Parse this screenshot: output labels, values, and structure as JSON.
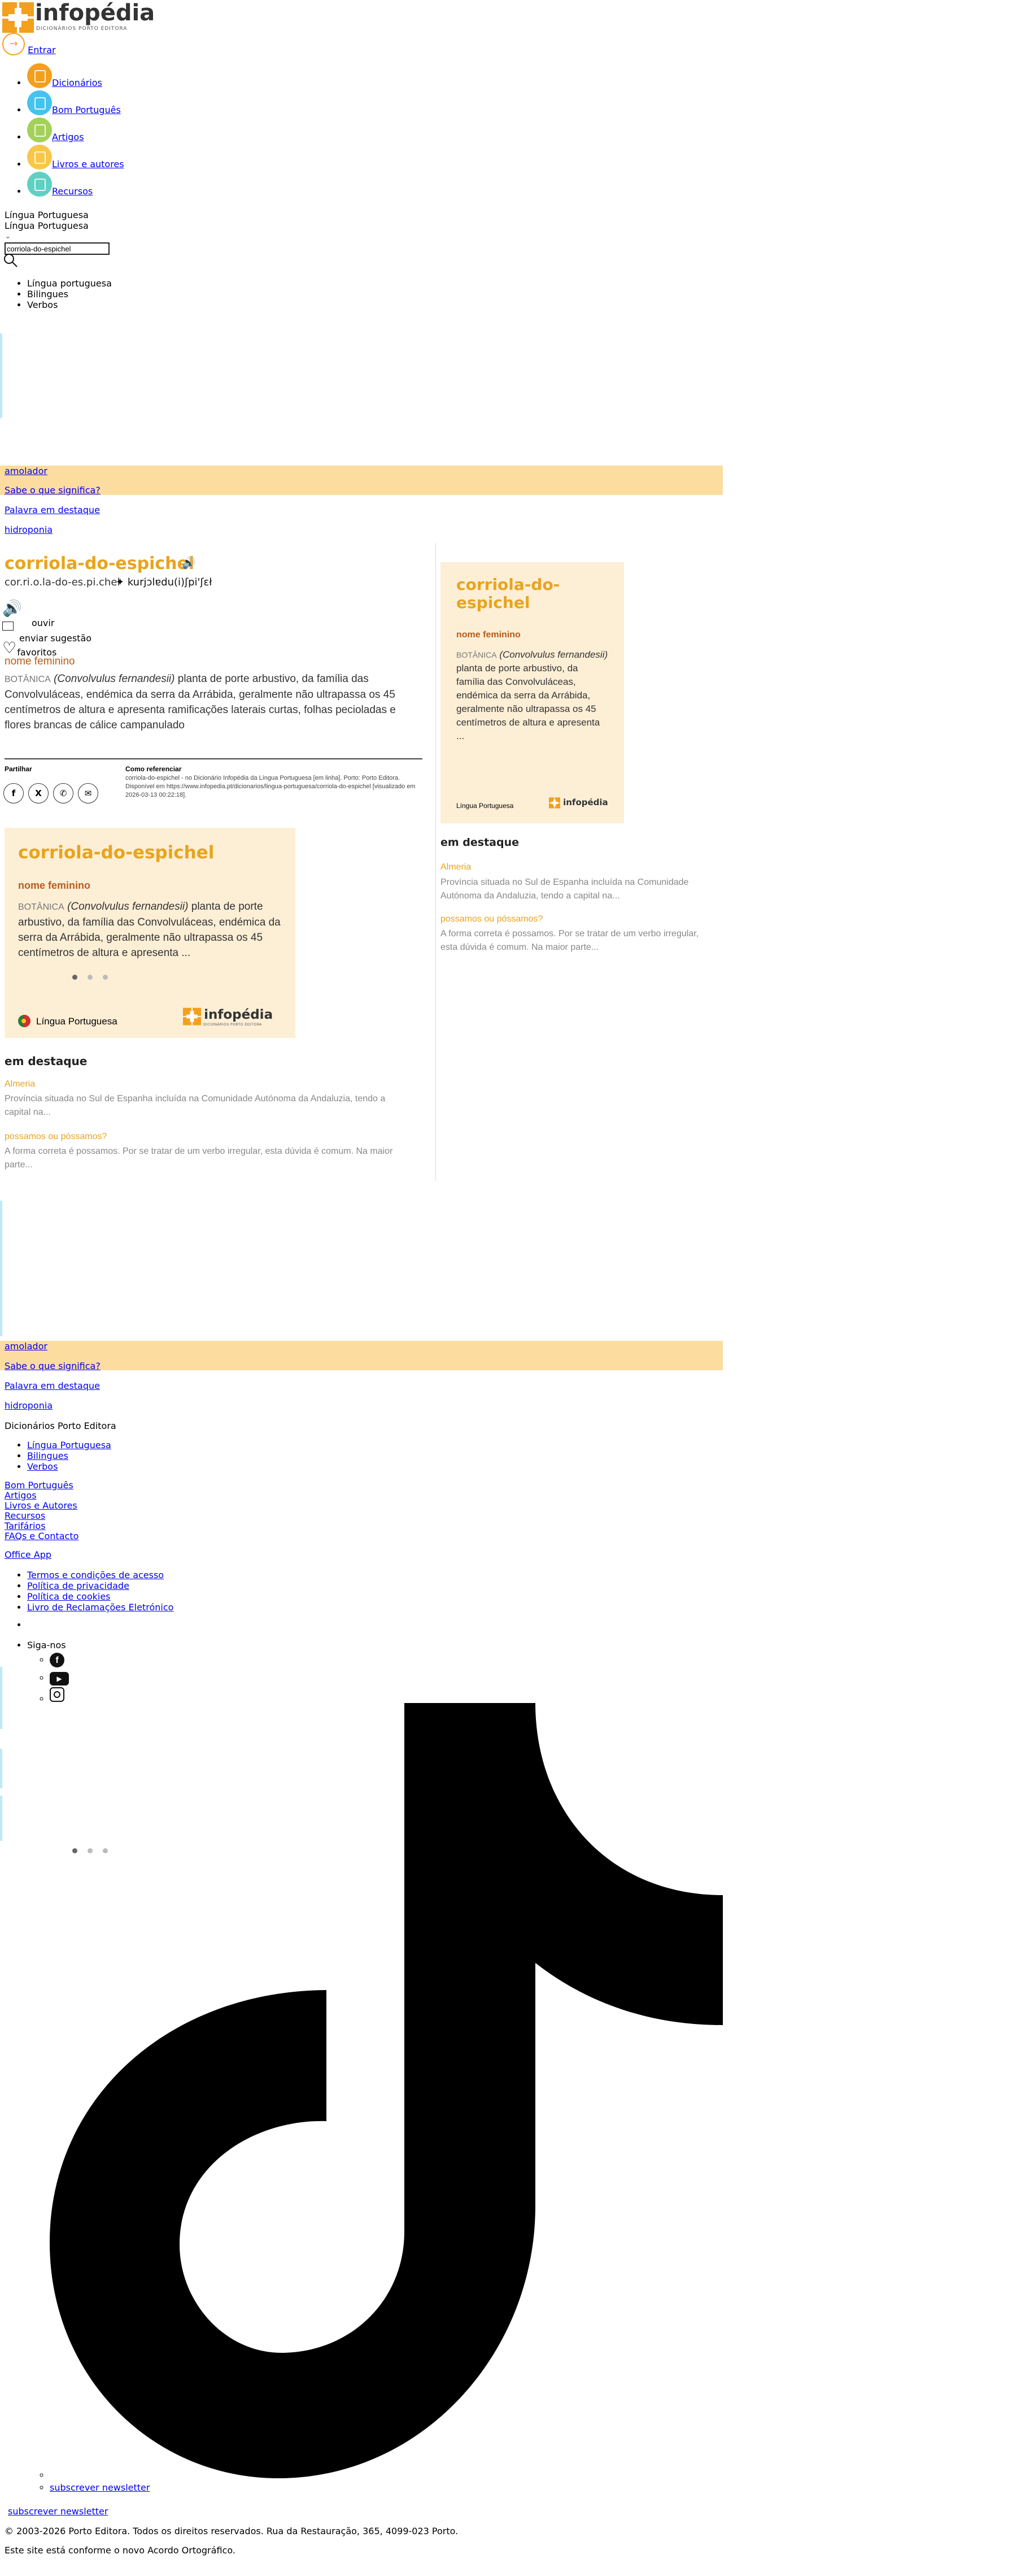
{
  "header": {
    "logo_text": "infopédia",
    "logo_subtitle": "DICIONÁRIOS PORTO EDITORA",
    "login_label": "Entrar",
    "nav": [
      {
        "label": "Dicionários",
        "color": "#f2a01d"
      },
      {
        "label": "Bom Português",
        "color": "#45c3ec"
      },
      {
        "label": "Artigos",
        "color": "#a3d15a"
      },
      {
        "label": "Livros e autores",
        "color": "#f8c74a"
      },
      {
        "label": "Recursos",
        "color": "#5fd0c2"
      }
    ],
    "dictionary_label": "Língua Portuguesa",
    "dictionary_selected": "Língua Portuguesa",
    "search_value": "corriola-do-espichel",
    "dictionary_options": [
      "Língua portuguesa",
      "Bilingues",
      "Verbos"
    ]
  },
  "promo_top": {
    "word_link": "amolador",
    "question_link": "Sabe o que significa?",
    "featured_link": "Palavra em destaque",
    "word_link_2": "hidroponia"
  },
  "entry": {
    "title": "corriola-do-espichel",
    "syllables": "cor.ri.o.la-do-es.pi.chel",
    "pronunciation": "kurjɔlɐdu(i)ʃpi'ʃɛł",
    "listen_label": "ouvir",
    "suggestion_label": "enviar sugestão",
    "favorites_label": "favoritos",
    "grammar": "nome feminino",
    "domain": "BOTÂNICA",
    "scientific_name": "(Convolvulus fernandesii)",
    "definition": "planta de porte arbustivo, da família das Convolvuláceas, endémica da serra da Arrábida, geralmente não ultrapassa os 45 centímetros de altura e apresenta ramificações laterais curtas, folhas pecioladas e flores brancas de cálice campanulado",
    "share_label": "Partilhar",
    "cite_label": "Como referenciar",
    "cite_text": "corriola-do-espichel - no Dicionário Infopédia da Língua Portuguesa [em linha]. Porto: Porto Editora. Disponível em https://www.infopedia.pt/dicionarios/lingua-portuguesa/corriola-do-espichel [visualizado em 2026-03-13 00:22:18].",
    "share_icons": [
      "facebook-icon",
      "x-icon",
      "whatsapp-icon",
      "email-icon"
    ]
  },
  "card": {
    "title": "corriola-do-espichel",
    "grammar": "nome feminino",
    "domain": "BOTÂNICA",
    "scientific_name": "(Convolvulus fernandesii)",
    "text": "planta de porte arbustivo, da família das Convolvuláceas, endémica da serra da Arrábida, geralmente não ultrapassa os 45 centímetros de altura e apresenta ...",
    "footer_label": "Língua Portuguesa",
    "logo_text": "infopédia",
    "logo_subtitle": "DICIONÁRIOS PORTO EDITORA"
  },
  "side_card": {
    "title": "corriola-do-espichel",
    "grammar": "nome feminino",
    "domain": "BOTÂNICA",
    "scientific_name": "(Convolvulus fernandesii)",
    "text": "planta de porte arbustivo, da família das Convolvuláceas, endémica da serra da Arrábida, geralmente não ultrapassa os 45 centímetros de altura e apresenta ...",
    "footer_label": "Língua Portuguesa",
    "logo_text": "infopédia"
  },
  "highlights": {
    "heading": "em destaque",
    "items": [
      {
        "title": "Almeria",
        "text": "Província situada no Sul de Espanha incluída na Comunidade Autónoma da Andaluzia, tendo a capital na..."
      },
      {
        "title": "possamos ou póssamos?",
        "text": "A forma correta é possamos. Por se tratar de um verbo irregular, esta dúvida é comum. Na maior parte..."
      }
    ]
  },
  "side_highlights": {
    "heading": "em destaque",
    "items": [
      {
        "title": "Almeria",
        "text": "Província situada no Sul de Espanha incluída na Comunidade Autónoma da Andaluzia, tendo a capital na..."
      },
      {
        "title": "possamos ou póssamos?",
        "text": "A forma correta é possamos. Por se tratar de um verbo irregular, esta dúvida é comum. Na maior parte..."
      }
    ]
  },
  "promo_bottom": {
    "word_link": "amolador",
    "question_link": "Sabe o que significa?",
    "featured_link": "Palavra em destaque",
    "word_link_2": "hidroponia"
  },
  "footer": {
    "dicts_heading": "Dicionários Porto Editora",
    "dicts": [
      "Língua Portuguesa",
      "Bilingues",
      "Verbos"
    ],
    "links": [
      "Bom Português",
      "Artigos",
      "Livros e Autores",
      "Recursos",
      "Tarifários",
      "FAQs e Contacto"
    ],
    "office_app": "Office App",
    "legal": [
      "Termos e condições de acesso",
      "Política de privacidade",
      "Política de cookies",
      "Livro de Reclamações Eletrónico"
    ],
    "follow_label": "Siga-nos",
    "newsletter_inner": "subscrever newsletter",
    "newsletter": "subscrever newsletter",
    "copyright": "© 2003-2026 Porto Editora. Todos os direitos reservados. Rua da Restauração, 365, 4099-023 Porto.",
    "agreement": "Este site está conforme o novo Acordo Ortográfico."
  }
}
